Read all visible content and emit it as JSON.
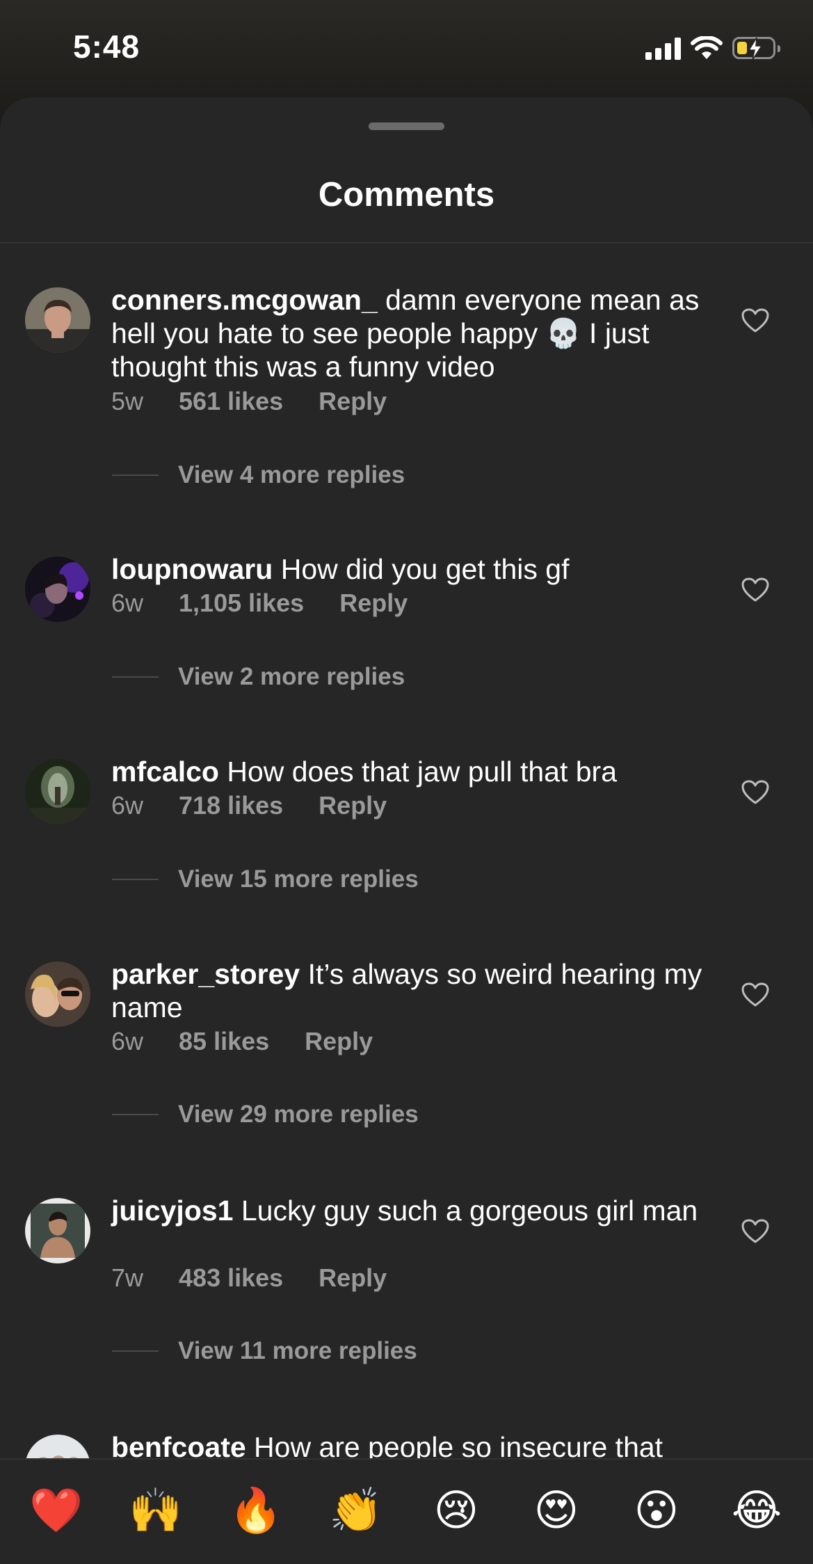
{
  "status_bar": {
    "time": "5:48",
    "icons": [
      "cellular-signal-icon",
      "wifi-icon",
      "battery-charging-icon"
    ]
  },
  "sheet": {
    "title": "Comments"
  },
  "comments": [
    {
      "username": "conners.mcgowan_",
      "text": " damn everyone mean as hell you hate to see people happy 💀 I just thought this was a funny video",
      "age": "5w",
      "likes": "561 likes",
      "reply": "Reply",
      "view_replies": "View 4 more replies"
    },
    {
      "username": "loupnowaru",
      "text": " How did you get this gf",
      "age": "6w",
      "likes": "1,105 likes",
      "reply": "Reply",
      "view_replies": "View 2 more replies"
    },
    {
      "username": "mfcalco",
      "text": " How does that jaw pull that bra",
      "age": "6w",
      "likes": "718 likes",
      "reply": "Reply",
      "view_replies": "View 15 more replies"
    },
    {
      "username": "parker_storey",
      "text": " It’s always so weird hearing my name",
      "age": "6w",
      "likes": "85 likes",
      "reply": "Reply",
      "view_replies": "View 29 more replies"
    },
    {
      "username": "juicyjos1",
      "text": " Lucky guy such a gorgeous girl man",
      "age": "7w",
      "likes": "483 likes",
      "reply": "Reply",
      "view_replies": "View 11 more replies"
    },
    {
      "username": "benfcoate",
      "text": " How are people so insecure that"
    }
  ],
  "reaction_bar": {
    "emojis": [
      "❤️",
      "🙌",
      "🔥",
      "👏",
      "😢",
      "😍",
      "😮",
      "😂"
    ],
    "emoji_names": [
      "red-heart",
      "raising-hands",
      "fire",
      "clapping-hands",
      "crying-face",
      "heart-eyes",
      "open-mouth-face",
      "tears-of-joy"
    ]
  },
  "colors": {
    "sheet_background": "#262627",
    "primary_text": "#ffffff",
    "secondary_text": "#9a9a9a"
  }
}
